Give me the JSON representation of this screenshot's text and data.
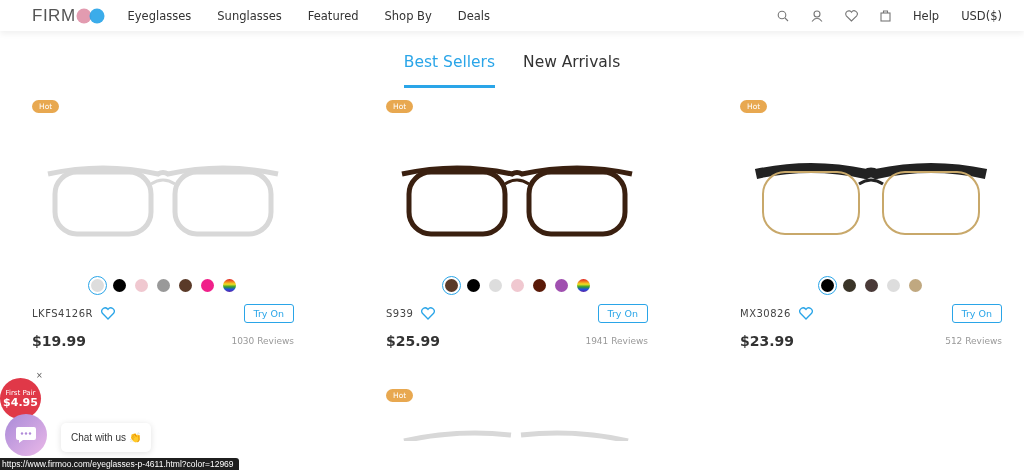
{
  "header": {
    "logo": "FIRM",
    "nav": [
      "Eyeglasses",
      "Sunglasses",
      "Featured",
      "Shop By",
      "Deals"
    ],
    "help": "Help",
    "currency": "USD($)"
  },
  "tabs": [
    {
      "label": "Best Sellers",
      "selected": true
    },
    {
      "label": "New Arrivals",
      "selected": false
    }
  ],
  "products": [
    {
      "badge": "Hot",
      "kind": "clear",
      "name": "LKFS4126R",
      "price": "$19.99",
      "reviews": "1030 Reviews",
      "button": "Try On",
      "swatches": [
        {
          "kind": "solid",
          "color": "#dddddd",
          "selected": true
        },
        {
          "kind": "solid",
          "color": "#000000",
          "selected": false
        },
        {
          "kind": "solid",
          "color": "#f0c8d0",
          "selected": false
        },
        {
          "kind": "solid",
          "color": "#999999",
          "selected": false
        },
        {
          "kind": "solid",
          "color": "#5a3a28",
          "selected": false
        },
        {
          "kind": "solid",
          "color": "#f0208a",
          "selected": false
        },
        {
          "kind": "rainbow",
          "selected": false
        }
      ]
    },
    {
      "badge": "Hot",
      "kind": "tortoise",
      "name": "S939",
      "price": "$25.99",
      "reviews": "1941 Reviews",
      "button": "Try On",
      "swatches": [
        {
          "kind": "solid",
          "color": "#5a3a28",
          "selected": true
        },
        {
          "kind": "solid",
          "color": "#000000",
          "selected": false
        },
        {
          "kind": "solid",
          "color": "#dddddd",
          "selected": false
        },
        {
          "kind": "solid",
          "color": "#f0c8d0",
          "selected": false
        },
        {
          "kind": "solid",
          "color": "#5a1a08",
          "selected": false
        },
        {
          "kind": "solid",
          "color": "#a050b0",
          "selected": false
        },
        {
          "kind": "rainbow",
          "selected": false
        }
      ]
    },
    {
      "badge": "Hot",
      "kind": "browline",
      "name": "MX30826",
      "price": "$23.99",
      "reviews": "512 Reviews",
      "button": "Try On",
      "swatches": [
        {
          "kind": "solid",
          "color": "#000000",
          "selected": true
        },
        {
          "kind": "solid",
          "color": "#3a3428",
          "selected": false
        },
        {
          "kind": "solid",
          "color": "#4a3a38",
          "selected": false
        },
        {
          "kind": "solid",
          "color": "#dddddd",
          "selected": false
        },
        {
          "kind": "solid",
          "color": "#c0a880",
          "selected": false
        }
      ]
    }
  ],
  "next_row": [
    {
      "badge": "Hot",
      "kind": "clear"
    }
  ],
  "promo": {
    "close": "×",
    "label": "First Pair",
    "price": "$4.95"
  },
  "chat": {
    "label": "Chat with us 👏"
  },
  "status_bar": {
    "url": "https://www.firmoo.com/eyeglasses-p-4611.html?color=12969"
  }
}
